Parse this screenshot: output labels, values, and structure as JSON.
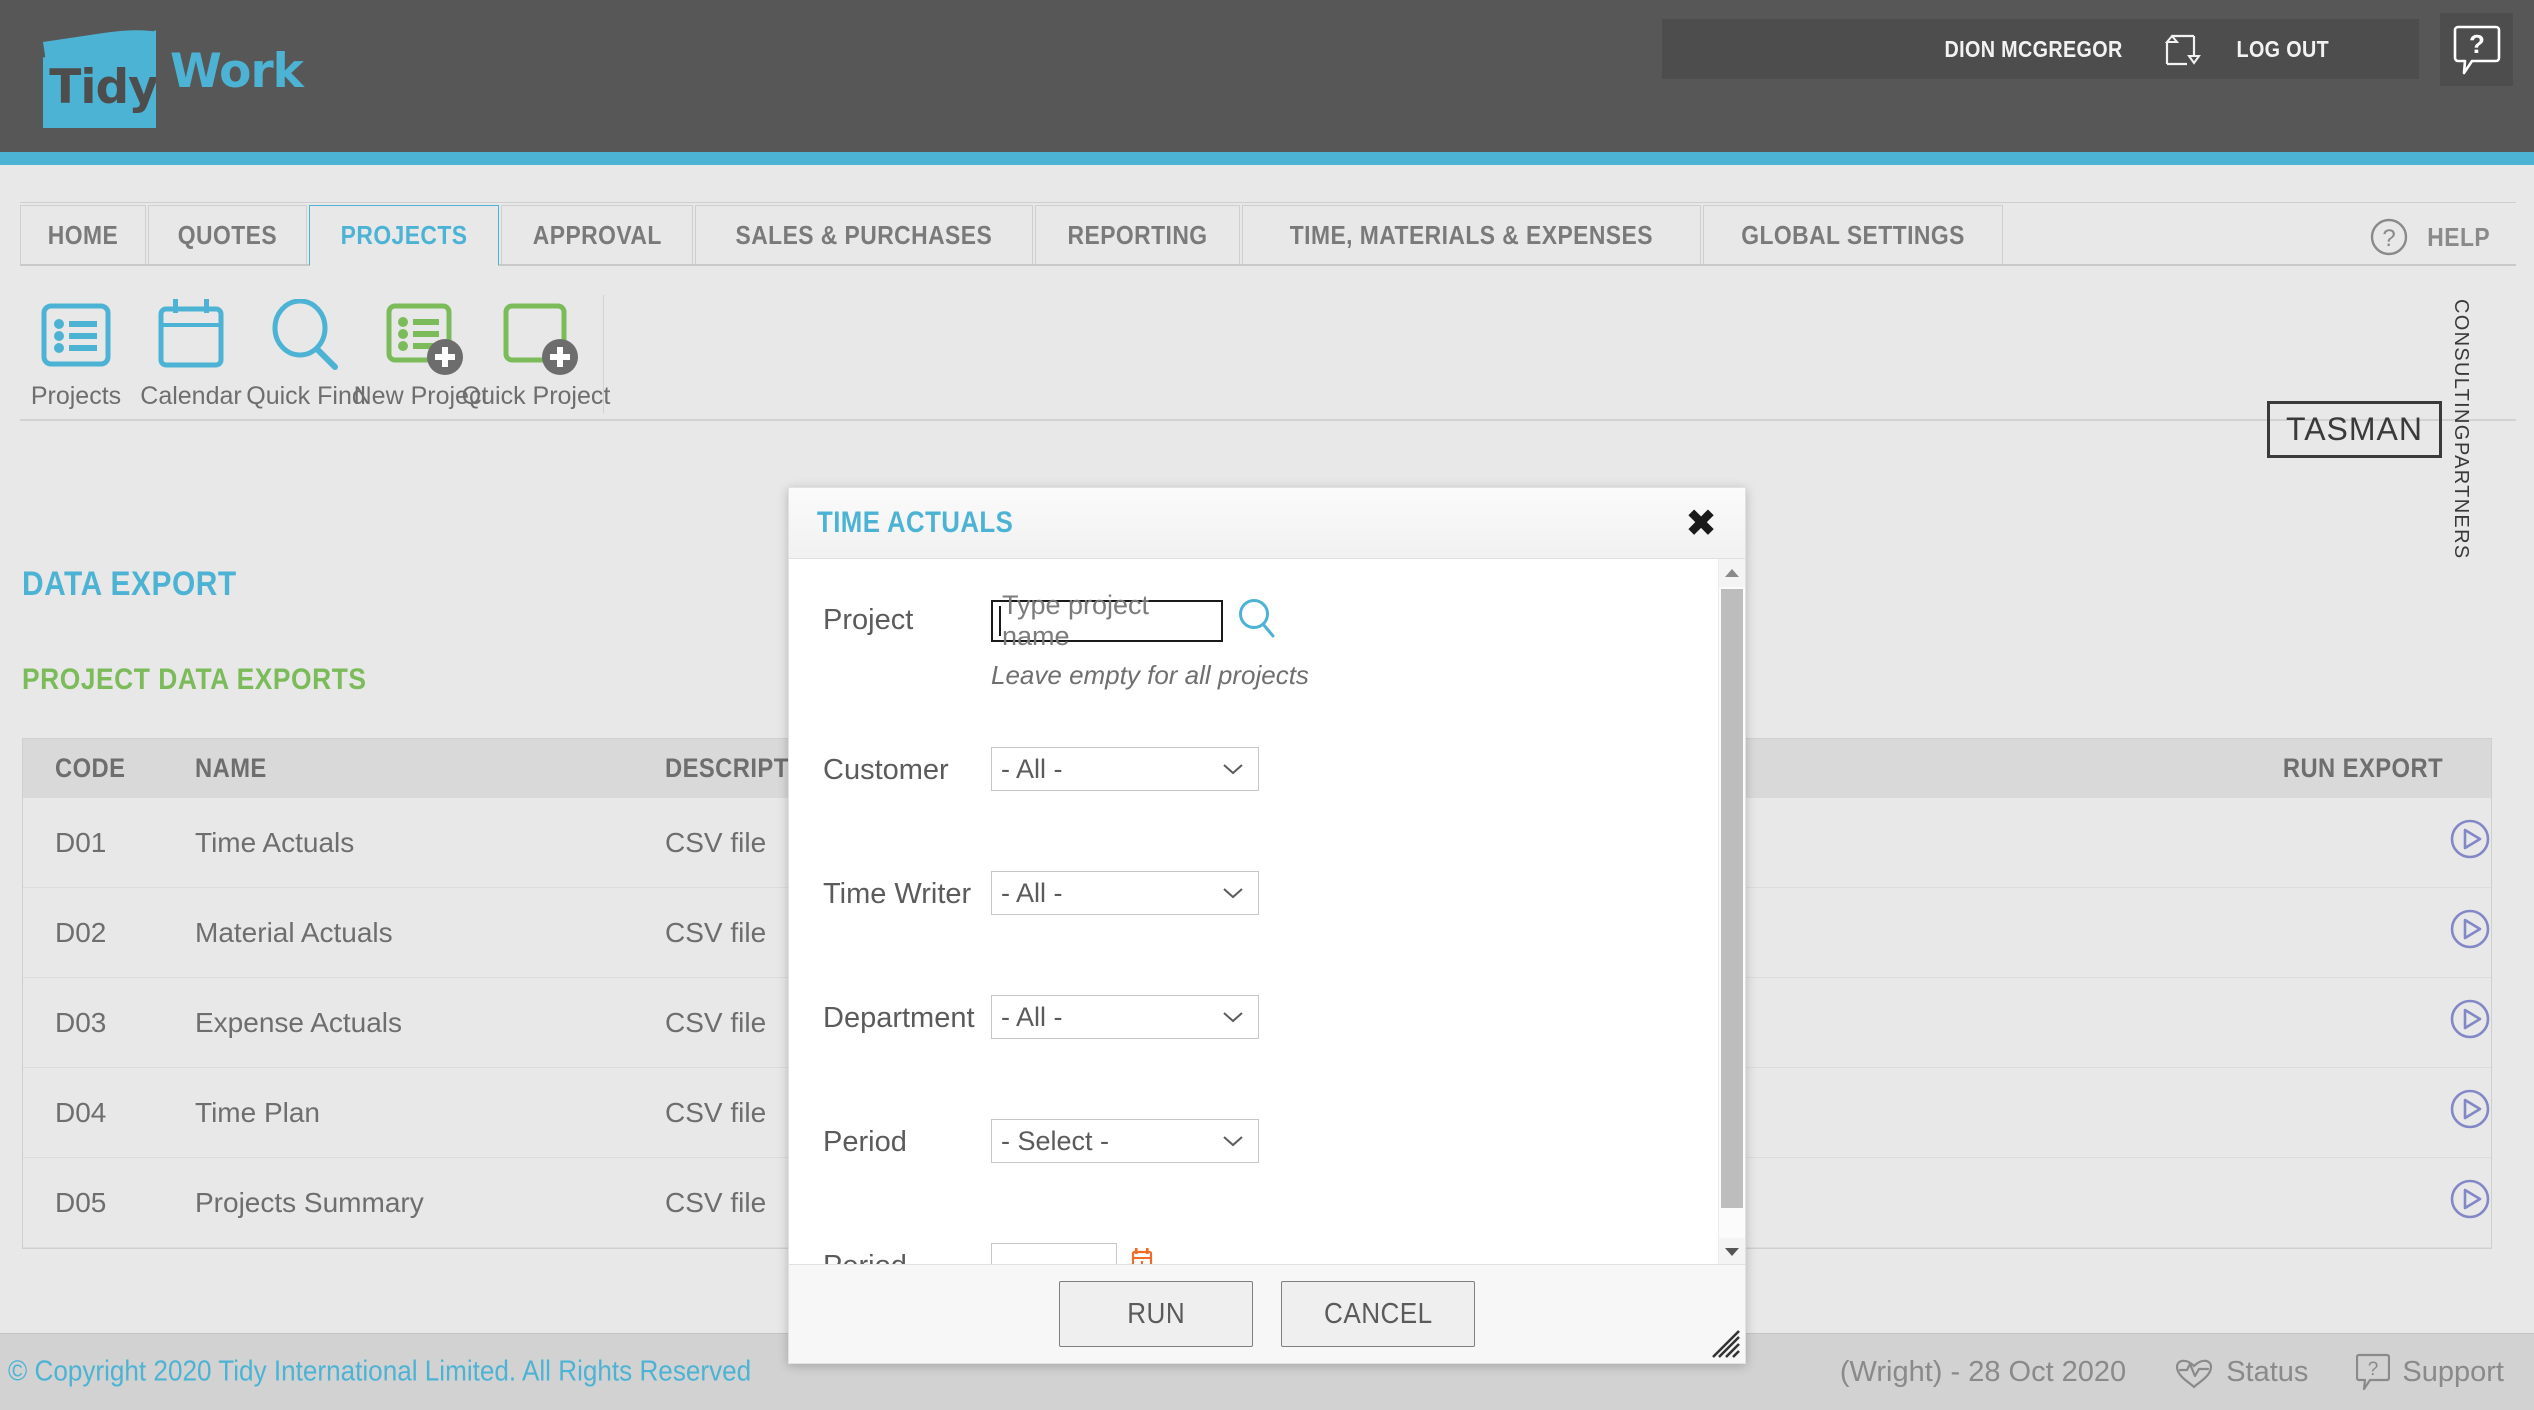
{
  "header": {
    "logo": {
      "part1": "Tidy",
      "part2": "Work"
    },
    "user_name": "DION MCGREGOR",
    "switch_user_icon": "switch-user-icon",
    "logout_label": "LOG OUT",
    "help_bubble_icon": "help-bubble-icon"
  },
  "nav": {
    "tabs": [
      {
        "label": "HOME",
        "active": false
      },
      {
        "label": "QUOTES",
        "active": false
      },
      {
        "label": "PROJECTS",
        "active": true
      },
      {
        "label": "APPROVAL",
        "active": false
      },
      {
        "label": "SALES & PURCHASES",
        "active": false
      },
      {
        "label": "REPORTING",
        "active": false
      },
      {
        "label": "TIME, MATERIALS & EXPENSES",
        "active": false
      },
      {
        "label": "GLOBAL SETTINGS",
        "active": false
      }
    ],
    "help_label": "HELP",
    "help_icon": "question-circle-icon"
  },
  "toolbar": {
    "items": [
      {
        "label": "Projects",
        "icon": "list-icon",
        "color": "#4cb3d4",
        "plus": false
      },
      {
        "label": "Calendar",
        "icon": "calendar-icon",
        "color": "#4cb3d4",
        "plus": false
      },
      {
        "label": "Quick Find",
        "icon": "magnifier-icon",
        "color": "#4cb3d4",
        "plus": false
      },
      {
        "label": "New Project",
        "icon": "list-icon",
        "color": "#7cbb5a",
        "plus": true
      },
      {
        "label": "Quick Project",
        "icon": "square-icon",
        "color": "#7cbb5a",
        "plus": true
      }
    ]
  },
  "brand": {
    "name": "TASMAN",
    "line1": "CONSULTING",
    "line2": "PARTNERS"
  },
  "main": {
    "page_title": "DATA EXPORT",
    "section_title": "PROJECT DATA EXPORTS",
    "table": {
      "columns": [
        "CODE",
        "NAME",
        "DESCRIPTION",
        "RUN EXPORT"
      ],
      "rows": [
        {
          "code": "D01",
          "name": "Time Actuals",
          "description": "CSV file",
          "run_icon": "play-circle-icon"
        },
        {
          "code": "D02",
          "name": "Material Actuals",
          "description": "CSV file",
          "run_icon": "play-circle-icon"
        },
        {
          "code": "D03",
          "name": "Expense Actuals",
          "description": "CSV file",
          "run_icon": "play-circle-icon"
        },
        {
          "code": "D04",
          "name": "Time Plan",
          "description": "CSV file",
          "run_icon": "play-circle-icon"
        },
        {
          "code": "D05",
          "name": "Projects Summary",
          "description": "CSV file",
          "run_icon": "play-circle-icon"
        }
      ]
    }
  },
  "modal": {
    "title": "TIME ACTUALS",
    "close_icon": "close-icon",
    "fields": {
      "project": {
        "label": "Project",
        "value": "",
        "placeholder": "Type project name",
        "search_icon": "search-icon",
        "hint": "Leave empty for all projects"
      },
      "customer": {
        "label": "Customer",
        "value": "- All -"
      },
      "time_writer": {
        "label": "Time Writer",
        "value": "- All -"
      },
      "department": {
        "label": "Department",
        "value": "- All -"
      },
      "period": {
        "label": "Period",
        "value": "- Select -"
      },
      "period_start": {
        "label": "Period Starting",
        "value": "",
        "calendar_icon": "calendar-plus-icon"
      }
    },
    "buttons": {
      "run": "RUN",
      "cancel": "CANCEL"
    },
    "scroll_icons": {
      "up": "scroll-up-arrow",
      "down": "scroll-down-arrow"
    },
    "resize_icon": "resize-grip-icon"
  },
  "footer": {
    "copyright": "© Copyright 2020 Tidy International Limited. All Rights Reserved",
    "version": "(Wright) - 28 Oct 2020",
    "status_label": "Status",
    "status_icon": "heartbeat-icon",
    "support_label": "Support",
    "support_icon": "support-bubble-icon"
  },
  "colors": {
    "brand_cyan": "#4cb3d4",
    "brand_green": "#7cbb5a",
    "accent_orange": "#f26a28",
    "run_purple": "#8287c6",
    "header_gray": "#575757"
  }
}
